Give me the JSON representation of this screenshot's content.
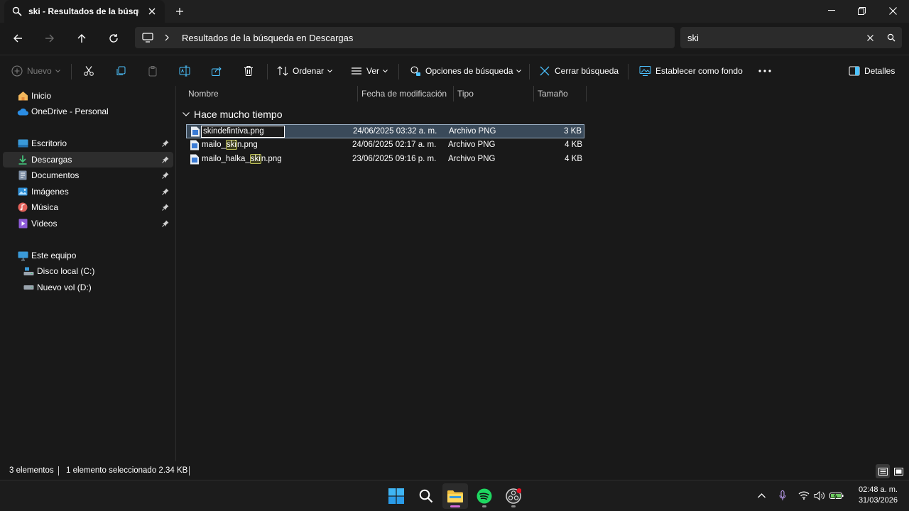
{
  "window": {
    "tab_title": "ski - Resultados de la búsqueda en Descargas"
  },
  "address": {
    "crumb": "Resultados de la búsqueda en Descargas",
    "search_value": "ski"
  },
  "toolbar": {
    "nuevo": "Nuevo",
    "ordenar": "Ordenar",
    "ver": "Ver",
    "opciones": "Opciones de búsqueda",
    "cerrar": "Cerrar búsqueda",
    "fondo": "Establecer como fondo",
    "detalles": "Detalles"
  },
  "sidebar": {
    "items": [
      {
        "label": "Inicio",
        "icon": "home-icon",
        "pinned": false
      },
      {
        "label": "OneDrive - Personal",
        "icon": "cloud-icon",
        "pinned": false
      },
      {
        "label": "Escritorio",
        "icon": "desktop-icon",
        "pinned": true
      },
      {
        "label": "Descargas",
        "icon": "download-icon",
        "pinned": true
      },
      {
        "label": "Documentos",
        "icon": "documents-icon",
        "pinned": true
      },
      {
        "label": "Imágenes",
        "icon": "pictures-icon",
        "pinned": true
      },
      {
        "label": "Música",
        "icon": "music-icon",
        "pinned": true
      },
      {
        "label": "Videos",
        "icon": "videos-icon",
        "pinned": true
      },
      {
        "label": "Este equipo",
        "icon": "computer-icon",
        "pinned": false
      },
      {
        "label": "Disco local (C:)",
        "icon": "drive-icon",
        "pinned": false
      },
      {
        "label": "Nuevo vol (D:)",
        "icon": "drive-icon",
        "pinned": false
      }
    ]
  },
  "columns": {
    "nombre": "Nombre",
    "fecha": "Fecha de modificación",
    "tipo": "Tipo",
    "tamano": "Tamaño"
  },
  "group": {
    "title": "Hace mucho tiempo"
  },
  "files": [
    {
      "name": "skindefintiva.png",
      "date": "24/06/2025 03:32 a. m.",
      "type": "Archivo PNG",
      "size": "3 KB",
      "selected": true
    },
    {
      "name_pre": "mailo_",
      "name_hl": "ski",
      "name_post": "n.png",
      "date": "24/06/2025 02:17 a. m.",
      "type": "Archivo PNG",
      "size": "4 KB"
    },
    {
      "name_pre": "mailo_halka_",
      "name_hl": "ski",
      "name_post": "n.png",
      "date": "23/06/2025 09:16 p. m.",
      "type": "Archivo PNG",
      "size": "4 KB"
    }
  ],
  "status": {
    "count": "3 elementos",
    "selection": "1 elemento seleccionado  2.34 KB"
  },
  "taskbar": {
    "time": "02:48 a. m.",
    "date": "31/03/2026"
  },
  "colors": {
    "background": "#191919",
    "selection": "#3a4a5a",
    "highlight": "#bdbf5a",
    "accent": "#4cc2ff"
  }
}
